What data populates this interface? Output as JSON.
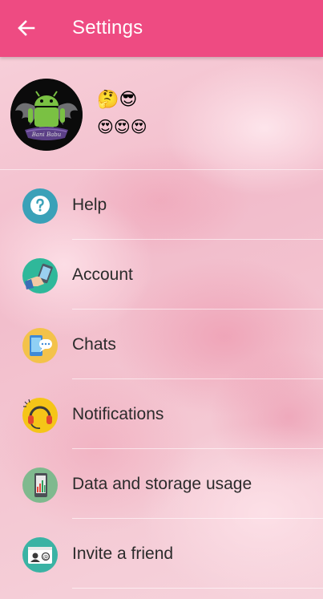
{
  "app_bar": {
    "title": "Settings",
    "back_icon": "arrow-left-icon",
    "color": "#ee4b82"
  },
  "profile": {
    "name": "🤔😎",
    "status": "😍😍😍",
    "avatar_caption": "Bani Babu"
  },
  "menu": [
    {
      "label": "Help",
      "icon": "help-icon"
    },
    {
      "label": "Account",
      "icon": "account-icon"
    },
    {
      "label": "Chats",
      "icon": "chats-icon"
    },
    {
      "label": "Notifications",
      "icon": "notifications-icon"
    },
    {
      "label": "Data and storage usage",
      "icon": "data-storage-icon"
    },
    {
      "label": "Invite a friend",
      "icon": "invite-friend-icon"
    }
  ]
}
